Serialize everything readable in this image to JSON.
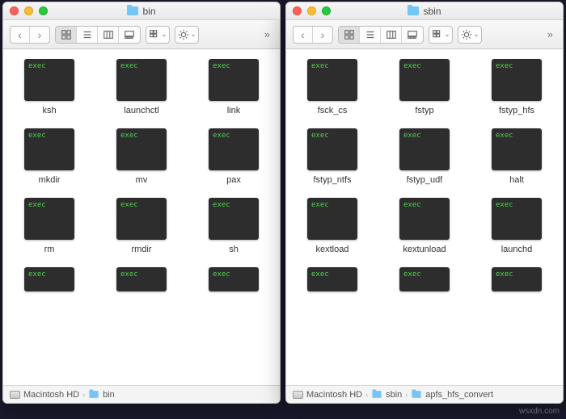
{
  "windows": [
    {
      "title": "bin",
      "items": [
        "ksh",
        "launchctl",
        "link",
        "mkdir",
        "mv",
        "pax",
        "rm",
        "rmdir",
        "sh"
      ],
      "path": [
        "Macintosh HD",
        "bin"
      ]
    },
    {
      "title": "sbin",
      "items": [
        "fsck_cs",
        "fstyp",
        "fstyp_hfs",
        "fstyp_ntfs",
        "fstyp_udf",
        "halt",
        "kextload",
        "kextunload",
        "launchd"
      ],
      "path": [
        "Macintosh HD",
        "sbin",
        "apfs_hfs_convert"
      ]
    }
  ],
  "exec_label": "exec",
  "watermark": "wsxdn.com"
}
